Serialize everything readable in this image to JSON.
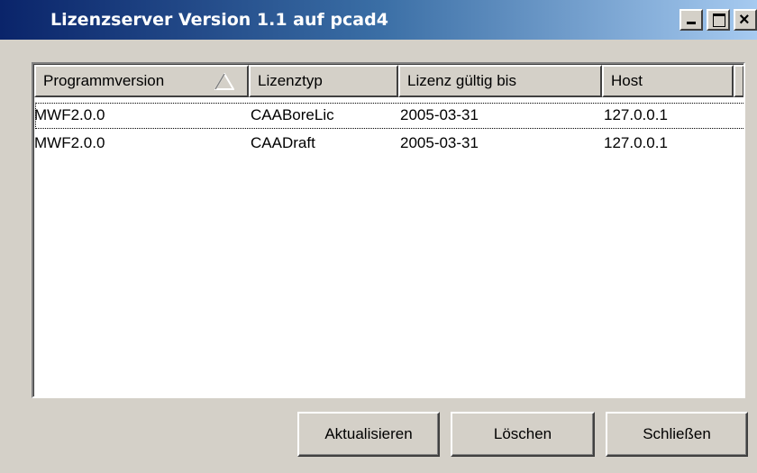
{
  "window": {
    "title": "Lizenzserver Version 1.1 auf pcad4",
    "minimize_icon": "minimize-icon",
    "maximize_icon": "maximize-icon",
    "close_icon": "close-icon",
    "close_glyph": "×"
  },
  "list": {
    "columns": [
      {
        "label": "Programmversion",
        "sort": "ascending"
      },
      {
        "label": "Lizenztyp"
      },
      {
        "label": "Lizenz gültig bis"
      },
      {
        "label": "Host"
      }
    ],
    "rows": [
      {
        "programmversion": "MWF2.0.0",
        "lizenztyp": "CAABoreLic",
        "gueltig_bis": "2005-03-31",
        "host": "127.0.0.1",
        "focused": true
      },
      {
        "programmversion": "MWF2.0.0",
        "lizenztyp": "CAADraft",
        "gueltig_bis": "2005-03-31",
        "host": "127.0.0.1",
        "focused": false
      }
    ]
  },
  "buttons": {
    "refresh": "Aktualisieren",
    "delete": "Löschen",
    "close": "Schließen"
  },
  "colors": {
    "titlebar_start": "#0a246a",
    "titlebar_end": "#a6caf0",
    "face": "#d4d0c8"
  }
}
